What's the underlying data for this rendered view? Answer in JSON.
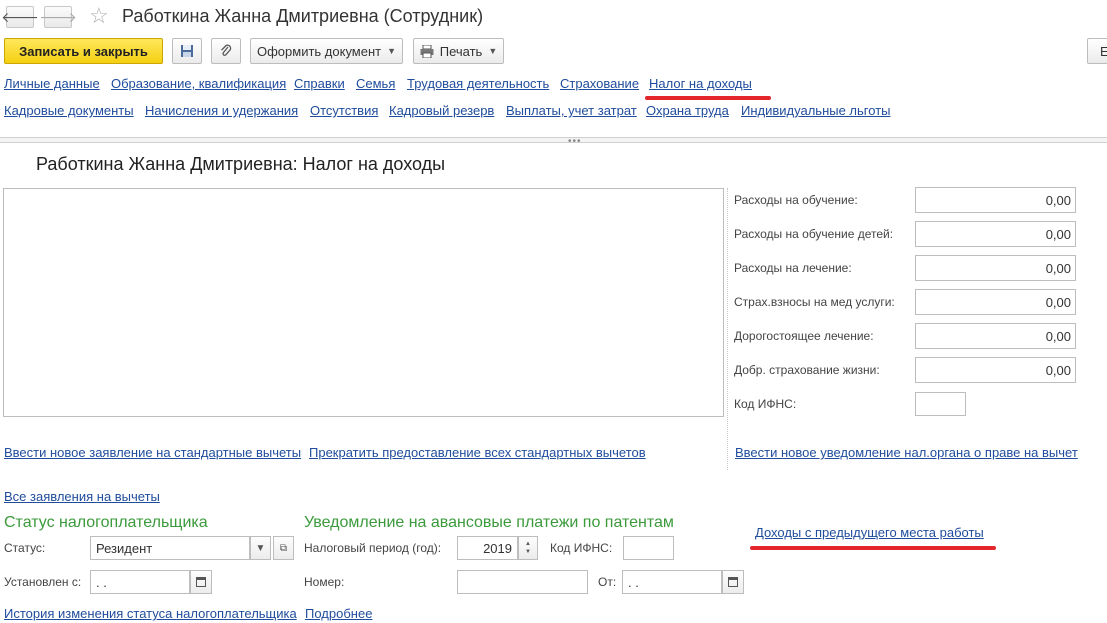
{
  "window": {
    "title": "Работкина Жанна Дмитриевна (Сотрудник)"
  },
  "toolbar": {
    "save_close": "Записать и закрыть",
    "create_document": "Оформить документ",
    "print": "Печать",
    "more": "Е"
  },
  "tabs_row1": [
    "Личные данные",
    "Образование, квалификация",
    "Справки",
    "Семья",
    "Трудовая деятельность",
    "Страхование",
    "Налог на доходы"
  ],
  "tabs_row2": [
    "Кадровые документы",
    "Начисления и удержания",
    "Отсутствия",
    "Кадровый резерв",
    "Выплаты, учет затрат",
    "Охрана труда",
    "Индивидуальные льготы"
  ],
  "section": {
    "title": "Работкина Жанна Дмитриевна: Налог на доходы"
  },
  "deductions": [
    {
      "label": "Расходы на обучение:",
      "value": "0,00"
    },
    {
      "label": "Расходы на обучение детей:",
      "value": "0,00"
    },
    {
      "label": "Расходы на лечение:",
      "value": "0,00"
    },
    {
      "label": "Страх.взносы на мед услуги:",
      "value": "0,00"
    },
    {
      "label": "Дорогостоящее лечение:",
      "value": "0,00"
    },
    {
      "label": "Добр. страхование жизни:",
      "value": "0,00"
    }
  ],
  "ifns_code_label": "Код ИФНС:",
  "links": {
    "new_standard": "Ввести новое заявление на стандартные вычеты",
    "stop_standard": "Прекратить предоставление всех стандартных вычетов",
    "new_notice": "Ввести новое уведомление нал.органа о праве на вычет",
    "all_applications": "Все заявления на вычеты",
    "prev_income": "Доходы с предыдущего места работы",
    "status_history": "История изменения статуса налогоплательщика",
    "more": "Подробнее"
  },
  "taxpayer": {
    "heading": "Статус налогоплательщика",
    "status_label": "Статус:",
    "status_value": "Резидент",
    "established_label": "Установлен с:",
    "established_value": " .  . "
  },
  "patents": {
    "heading": "Уведомление на авансовые платежи по патентам",
    "period_label": "Налоговый период (год):",
    "period_value": "2019",
    "ifns_label": "Код ИФНС:",
    "number_label": "Номер:",
    "from_label": "От:",
    "from_value": " .  . "
  },
  "colors": {
    "link": "#1f4c9c",
    "section_heading": "#3b9a3b",
    "highlight": "#e2262b",
    "primary_button": "#f4cf12"
  }
}
